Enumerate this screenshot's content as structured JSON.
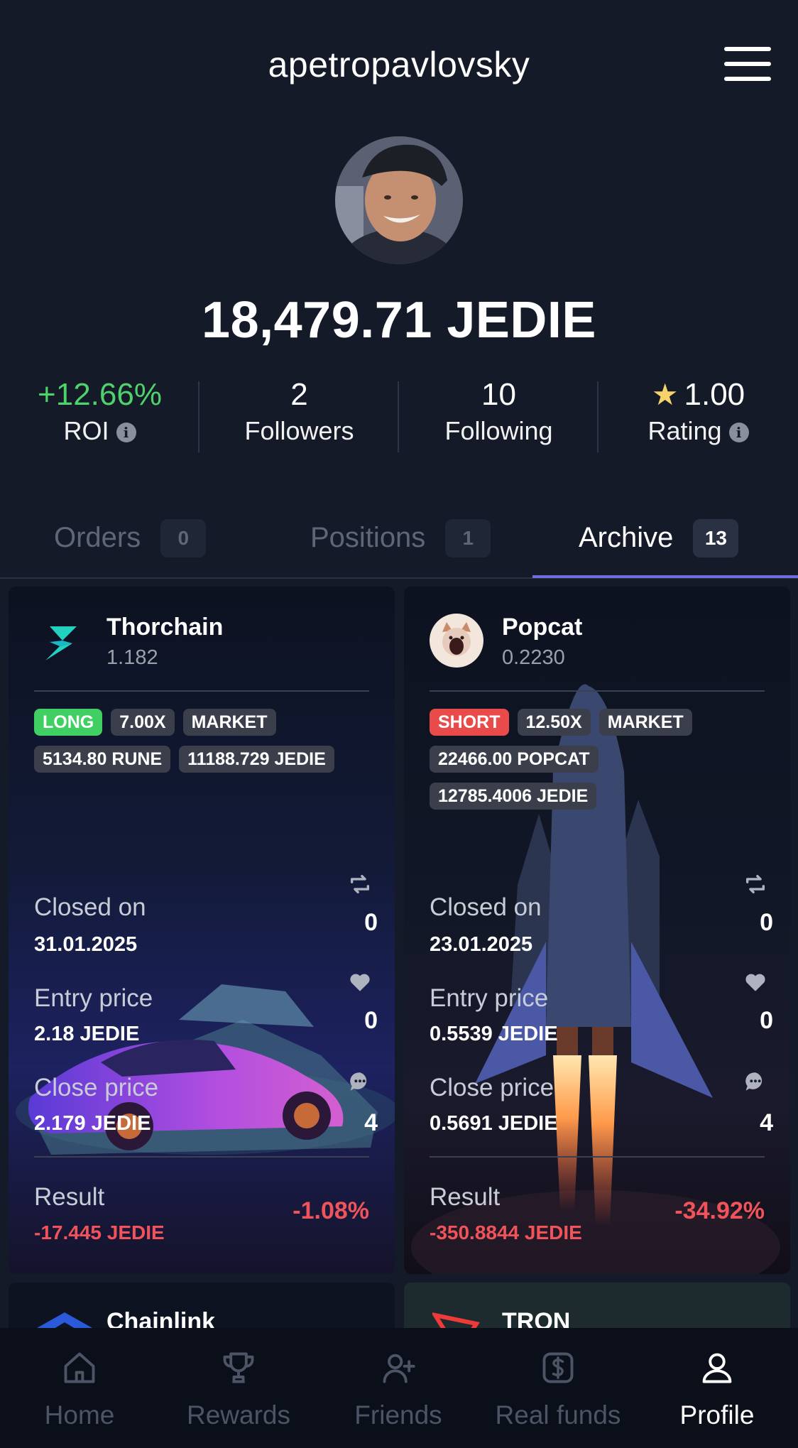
{
  "header": {
    "username": "apetropavlovsky"
  },
  "profile": {
    "balance": "18,479.71 JEDIE"
  },
  "stats": {
    "roi": {
      "value": "+12.66%",
      "label": "ROI"
    },
    "followers": {
      "value": "2",
      "label": "Followers"
    },
    "following": {
      "value": "10",
      "label": "Following"
    },
    "rating": {
      "value": "1.00",
      "label": "Rating"
    }
  },
  "tabs": [
    {
      "label": "Orders",
      "count": "0"
    },
    {
      "label": "Positions",
      "count": "1"
    },
    {
      "label": "Archive",
      "count": "13",
      "active": true
    }
  ],
  "cards": [
    {
      "name": "Thorchain",
      "price": "1.182",
      "tags_row1": [
        "LONG",
        "7.00X",
        "MARKET"
      ],
      "tags_row2": [
        "5134.80 RUNE",
        "11188.729 JEDIE"
      ],
      "closed_label": "Closed on",
      "closed_value": "31.01.2025",
      "entry_label": "Entry price",
      "entry_value": "2.18 JEDIE",
      "close_label": "Close price",
      "close_value": "2.179 JEDIE",
      "reposts": "0",
      "likes": "0",
      "comments": "4",
      "result_label": "Result",
      "result_value": "-17.445 JEDIE",
      "result_pct": "-1.08%"
    },
    {
      "name": "Popcat",
      "price": "0.2230",
      "tags_row1": [
        "SHORT",
        "12.50X",
        "MARKET"
      ],
      "tags_row2": [
        "22466.00 POPCAT"
      ],
      "tags_row3": [
        "12785.4006 JEDIE"
      ],
      "closed_label": "Closed on",
      "closed_value": "23.01.2025",
      "entry_label": "Entry price",
      "entry_value": "0.5539 JEDIE",
      "close_label": "Close price",
      "close_value": "0.5691 JEDIE",
      "reposts": "0",
      "likes": "0",
      "comments": "4",
      "result_label": "Result",
      "result_value": "-350.8844 JEDIE",
      "result_pct": "-34.92%"
    }
  ],
  "more_cards": [
    {
      "name": "Chainlink"
    },
    {
      "name": "TRON"
    }
  ],
  "nav": [
    {
      "label": "Home",
      "icon": "home-icon"
    },
    {
      "label": "Rewards",
      "icon": "trophy-icon"
    },
    {
      "label": "Friends",
      "icon": "add-user-icon"
    },
    {
      "label": "Real funds",
      "icon": "dollar-wallet-icon"
    },
    {
      "label": "Profile",
      "icon": "user-icon",
      "active": true
    }
  ],
  "colors": {
    "positive": "#4fd16b",
    "negative": "#f0545a",
    "accent": "#6d6ee0",
    "long": "#3fcf62",
    "short": "#e94b4b"
  }
}
